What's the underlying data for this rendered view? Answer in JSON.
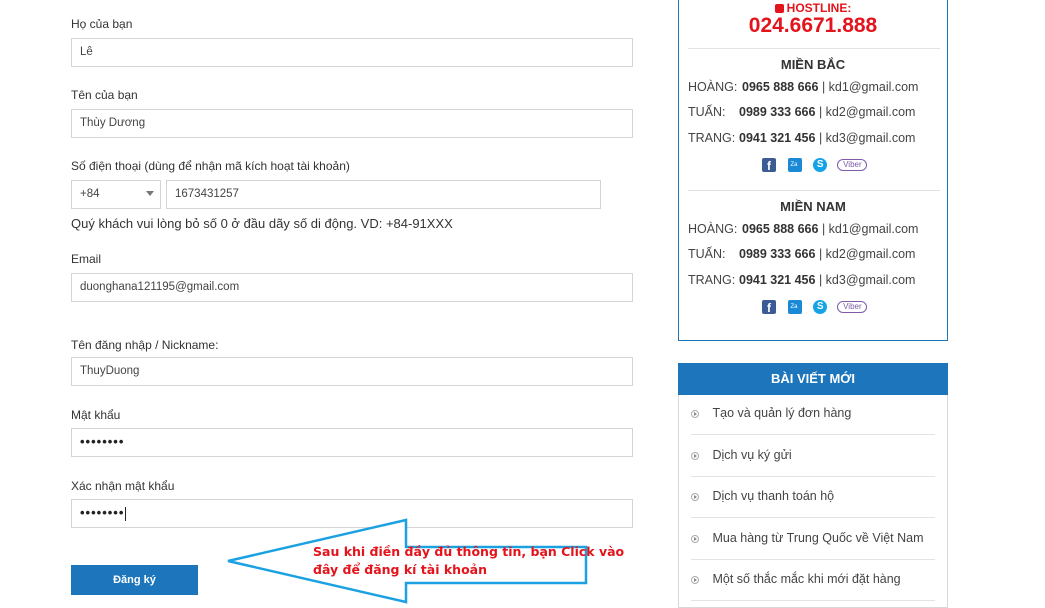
{
  "form": {
    "ho_label": "Họ của bạn",
    "ho_value": "Lê",
    "ten_label": "Tên của bạn",
    "ten_value": "Thùy Dương",
    "phone_label": "Số điện thoại (dùng để nhận mã kích hoạt tài khoản)",
    "country_code": "+84",
    "phone_value": "1673431257",
    "phone_hint": "Quý khách vui lòng bỏ số 0 ở đầu dãy số di động. VD: +84-91XXX",
    "email_label": "Email",
    "email_value": "duonghana121195@gmail.com",
    "username_label": "Tên đăng nhập / Nickname:",
    "username_value": "ThuyDuong",
    "password_label": "Mật khẩu",
    "password_mask": "••••••••",
    "confirm_label": "Xác nhận mật khẩu",
    "confirm_mask": "••••••••",
    "submit_label": "Đăng ký"
  },
  "annotation": {
    "line1": "Sau khi điền đầy đủ thông tin, bạn Click vào",
    "line2": "đây để đăng kí tài khoản",
    "arrow_color": "#1ba1e2",
    "text_color": "#e3141b"
  },
  "contact": {
    "hotline_label": "HOSTLINE:",
    "hotline_number": "024.6671.888",
    "regions": [
      {
        "name": "MIỀN BẮC",
        "rows": [
          {
            "name": "HOÀNG:",
            "phone": "0965 888 666",
            "email": "| kd1@gmail.com"
          },
          {
            "name": "TUẤN:",
            "phone": "0989 333 666",
            "email": "| kd2@gmail.com"
          },
          {
            "name": "TRANG:",
            "phone": "0941 321 456",
            "email": "| kd3@gmail.com"
          }
        ],
        "social": [
          "facebook",
          "zalo",
          "skype",
          "viber"
        ]
      },
      {
        "name": "MIỀN NAM",
        "rows": [
          {
            "name": "HOÀNG:",
            "phone": "0965 888 666",
            "email": "| kd1@gmail.com"
          },
          {
            "name": "TUẤN:",
            "phone": "0989 333 666",
            "email": "| kd2@gmail.com"
          },
          {
            "name": "TRANG:",
            "phone": "0941 321 456",
            "email": "| kd3@gmail.com"
          }
        ],
        "social": [
          "facebook",
          "zalo",
          "skype",
          "viber"
        ]
      }
    ],
    "viber_text": "Viber"
  },
  "posts": {
    "title": "BÀI VIẾT MỚI",
    "items": [
      "Tạo và quản lý đơn hàng",
      "Dịch vụ ký gửi",
      "Dịch vụ thanh toán hộ",
      "Mua hàng từ Trung Quốc về Việt Nam",
      "Một số thắc mắc khi mới đặt hàng"
    ]
  },
  "colors": {
    "brand_blue": "#1d76bc",
    "hotline_red": "#e3141b"
  }
}
